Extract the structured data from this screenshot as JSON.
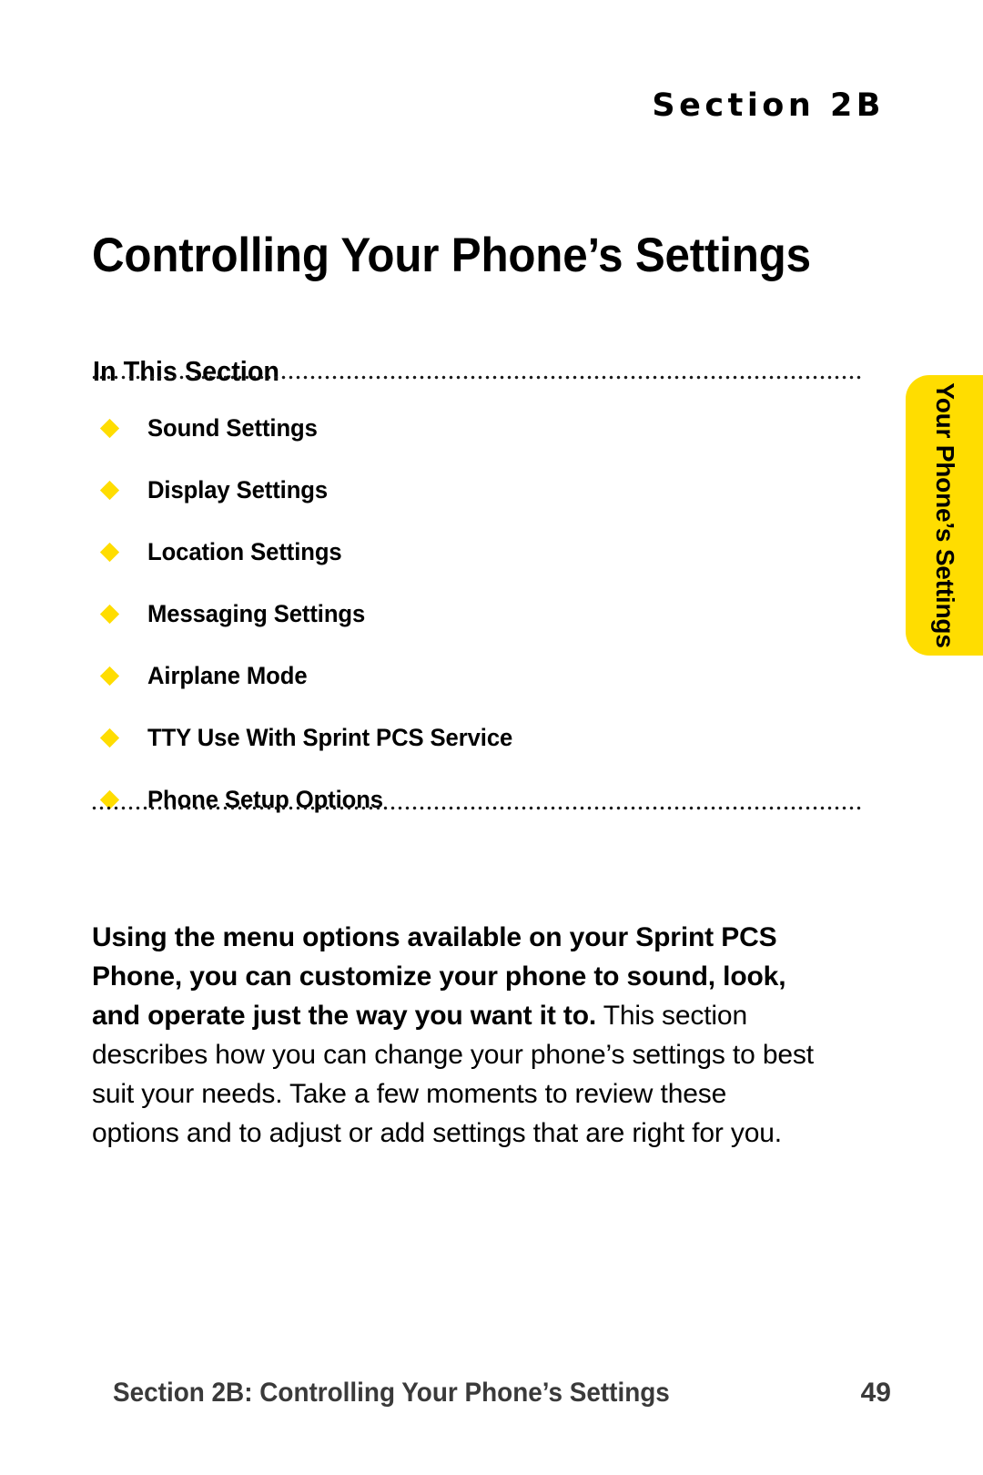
{
  "header": {
    "section_label": "Section 2B"
  },
  "title": "Controlling Your Phone’s Settings",
  "in_this_section": {
    "heading": "In This Section",
    "items": [
      {
        "label": "Sound Settings",
        "bullet": "diamond-bullet-icon"
      },
      {
        "label": "Display Settings",
        "bullet": "diamond-bullet-icon"
      },
      {
        "label": "Location Settings",
        "bullet": "diamond-bullet-icon"
      },
      {
        "label": "Messaging Settings",
        "bullet": "diamond-bullet-icon"
      },
      {
        "label": "Airplane Mode",
        "bullet": "diamond-bullet-icon"
      },
      {
        "label": "TTY Use With Sprint PCS Service",
        "bullet": "diamond-bullet-icon"
      },
      {
        "label": "Phone Setup Options",
        "bullet": "diamond-bullet-icon"
      }
    ]
  },
  "side_tab": {
    "label": "Your Phone’s Settings",
    "color": "#FFDD00"
  },
  "body": {
    "lead": "Using the menu options available on your Sprint PCS Phone, you can customize your phone to sound, look, and operate just the way you want it to.",
    "rest": " This section describes how you can change your phone’s settings to best suit your needs. Take a few moments to review these options and to adjust or add settings that are right for you."
  },
  "footer": {
    "text": "Section 2B: Controlling Your Phone’s Settings",
    "page_number": "49",
    "color": "#3a3a3a"
  },
  "colors": {
    "accent_yellow": "#FFDD00",
    "text_black": "#000000",
    "footer_gray": "#3a3a3a"
  }
}
